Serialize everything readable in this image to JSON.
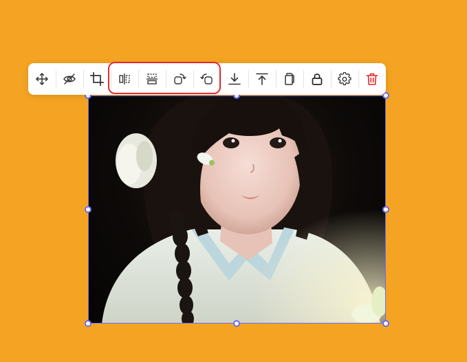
{
  "colors": {
    "background": "#f4a422",
    "selection": "#6b6cf0",
    "icon": "#333333",
    "delete": "#e0262b",
    "highlight": "#e32b2b"
  },
  "image": {
    "description_icon": "photo-image"
  },
  "toolbar": {
    "buttons": [
      {
        "id": "move",
        "icon": "move-icon"
      },
      {
        "id": "hide",
        "icon": "eye-off-icon"
      },
      {
        "id": "crop",
        "icon": "crop-icon"
      },
      {
        "id": "flip-horizontal",
        "icon": "flip-horizontal-icon"
      },
      {
        "id": "flip-vertical",
        "icon": "flip-vertical-icon"
      },
      {
        "id": "rotate-right",
        "icon": "rotate-clockwise-icon"
      },
      {
        "id": "rotate-left",
        "icon": "rotate-counterclockwise-icon"
      },
      {
        "id": "send-backward",
        "icon": "move-down-icon"
      },
      {
        "id": "bring-to-front",
        "icon": "move-to-top-icon"
      },
      {
        "id": "duplicate",
        "icon": "copy-icon"
      },
      {
        "id": "lock",
        "icon": "lock-icon"
      },
      {
        "id": "settings",
        "icon": "gear-icon"
      },
      {
        "id": "delete",
        "icon": "trash-icon"
      }
    ]
  }
}
